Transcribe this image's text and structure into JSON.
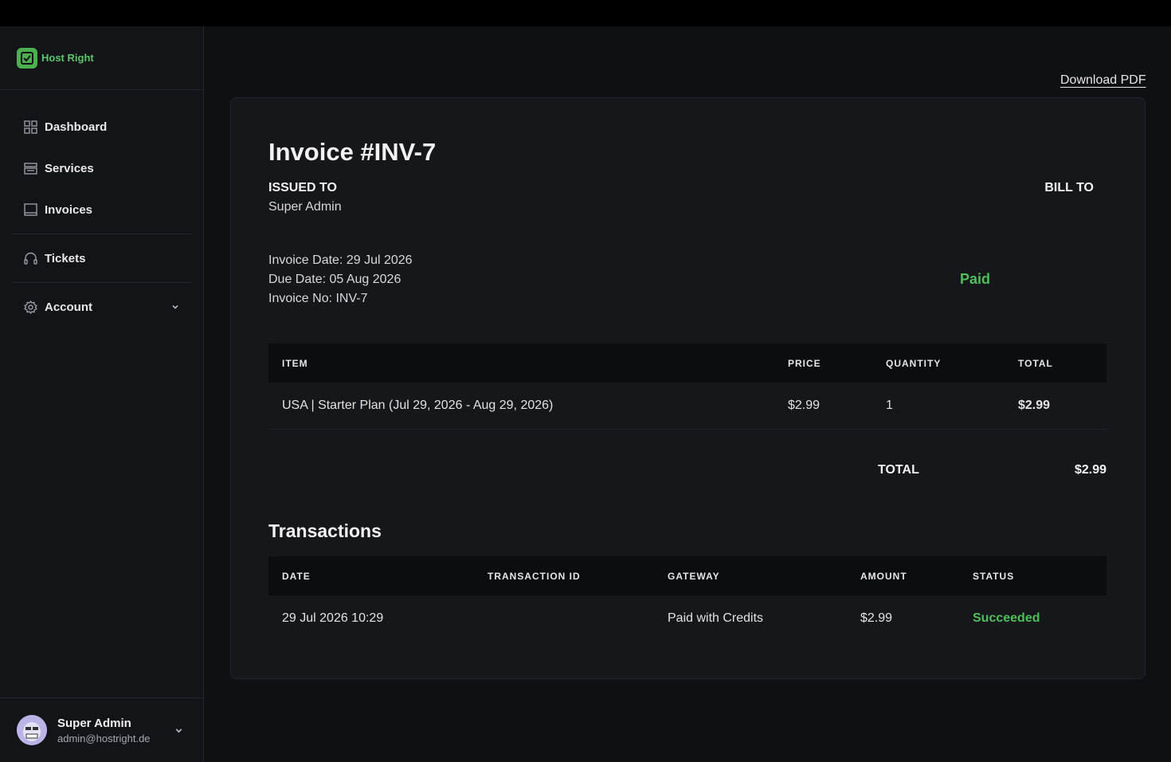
{
  "brand": {
    "name": "Host Right",
    "accent": "#4caf50"
  },
  "sidebar": {
    "items": [
      {
        "label": "Dashboard",
        "icon": "grid-icon"
      },
      {
        "label": "Services",
        "icon": "server-icon"
      },
      {
        "label": "Invoices",
        "icon": "invoice-icon"
      },
      {
        "label": "Tickets",
        "icon": "headset-icon"
      },
      {
        "label": "Account",
        "icon": "gear-icon"
      }
    ]
  },
  "user": {
    "name": "Super Admin",
    "email": "admin@hostright.de"
  },
  "toolbar": {
    "download_label": "Download PDF"
  },
  "invoice": {
    "title": "Invoice #INV-7",
    "issued_to_label": "ISSUED TO",
    "issued_to_value": "Super Admin",
    "bill_to_label": "BILL TO",
    "invoice_date": "Invoice Date: 29 Jul 2026",
    "due_date": "Due Date: 05 Aug 2026",
    "invoice_no": "Invoice No: INV-7",
    "status": "Paid",
    "status_color": "#4fbf5a"
  },
  "items_table": {
    "headers": [
      "ITEM",
      "PRICE",
      "QUANTITY",
      "TOTAL"
    ],
    "rows": [
      {
        "item": "USA | Starter Plan (Jul 29, 2026 - Aug 29, 2026)",
        "price": "$2.99",
        "quantity": "1",
        "total": "$2.99"
      }
    ]
  },
  "totals": {
    "label": "TOTAL",
    "value": "$2.99"
  },
  "transactions": {
    "title": "Transactions",
    "headers": [
      "DATE",
      "TRANSACTION ID",
      "GATEWAY",
      "AMOUNT",
      "STATUS"
    ],
    "rows": [
      {
        "date": "29 Jul 2026 10:29",
        "transaction_id": "",
        "gateway": "Paid with Credits",
        "amount": "$2.99",
        "status": "Succeeded"
      }
    ]
  }
}
